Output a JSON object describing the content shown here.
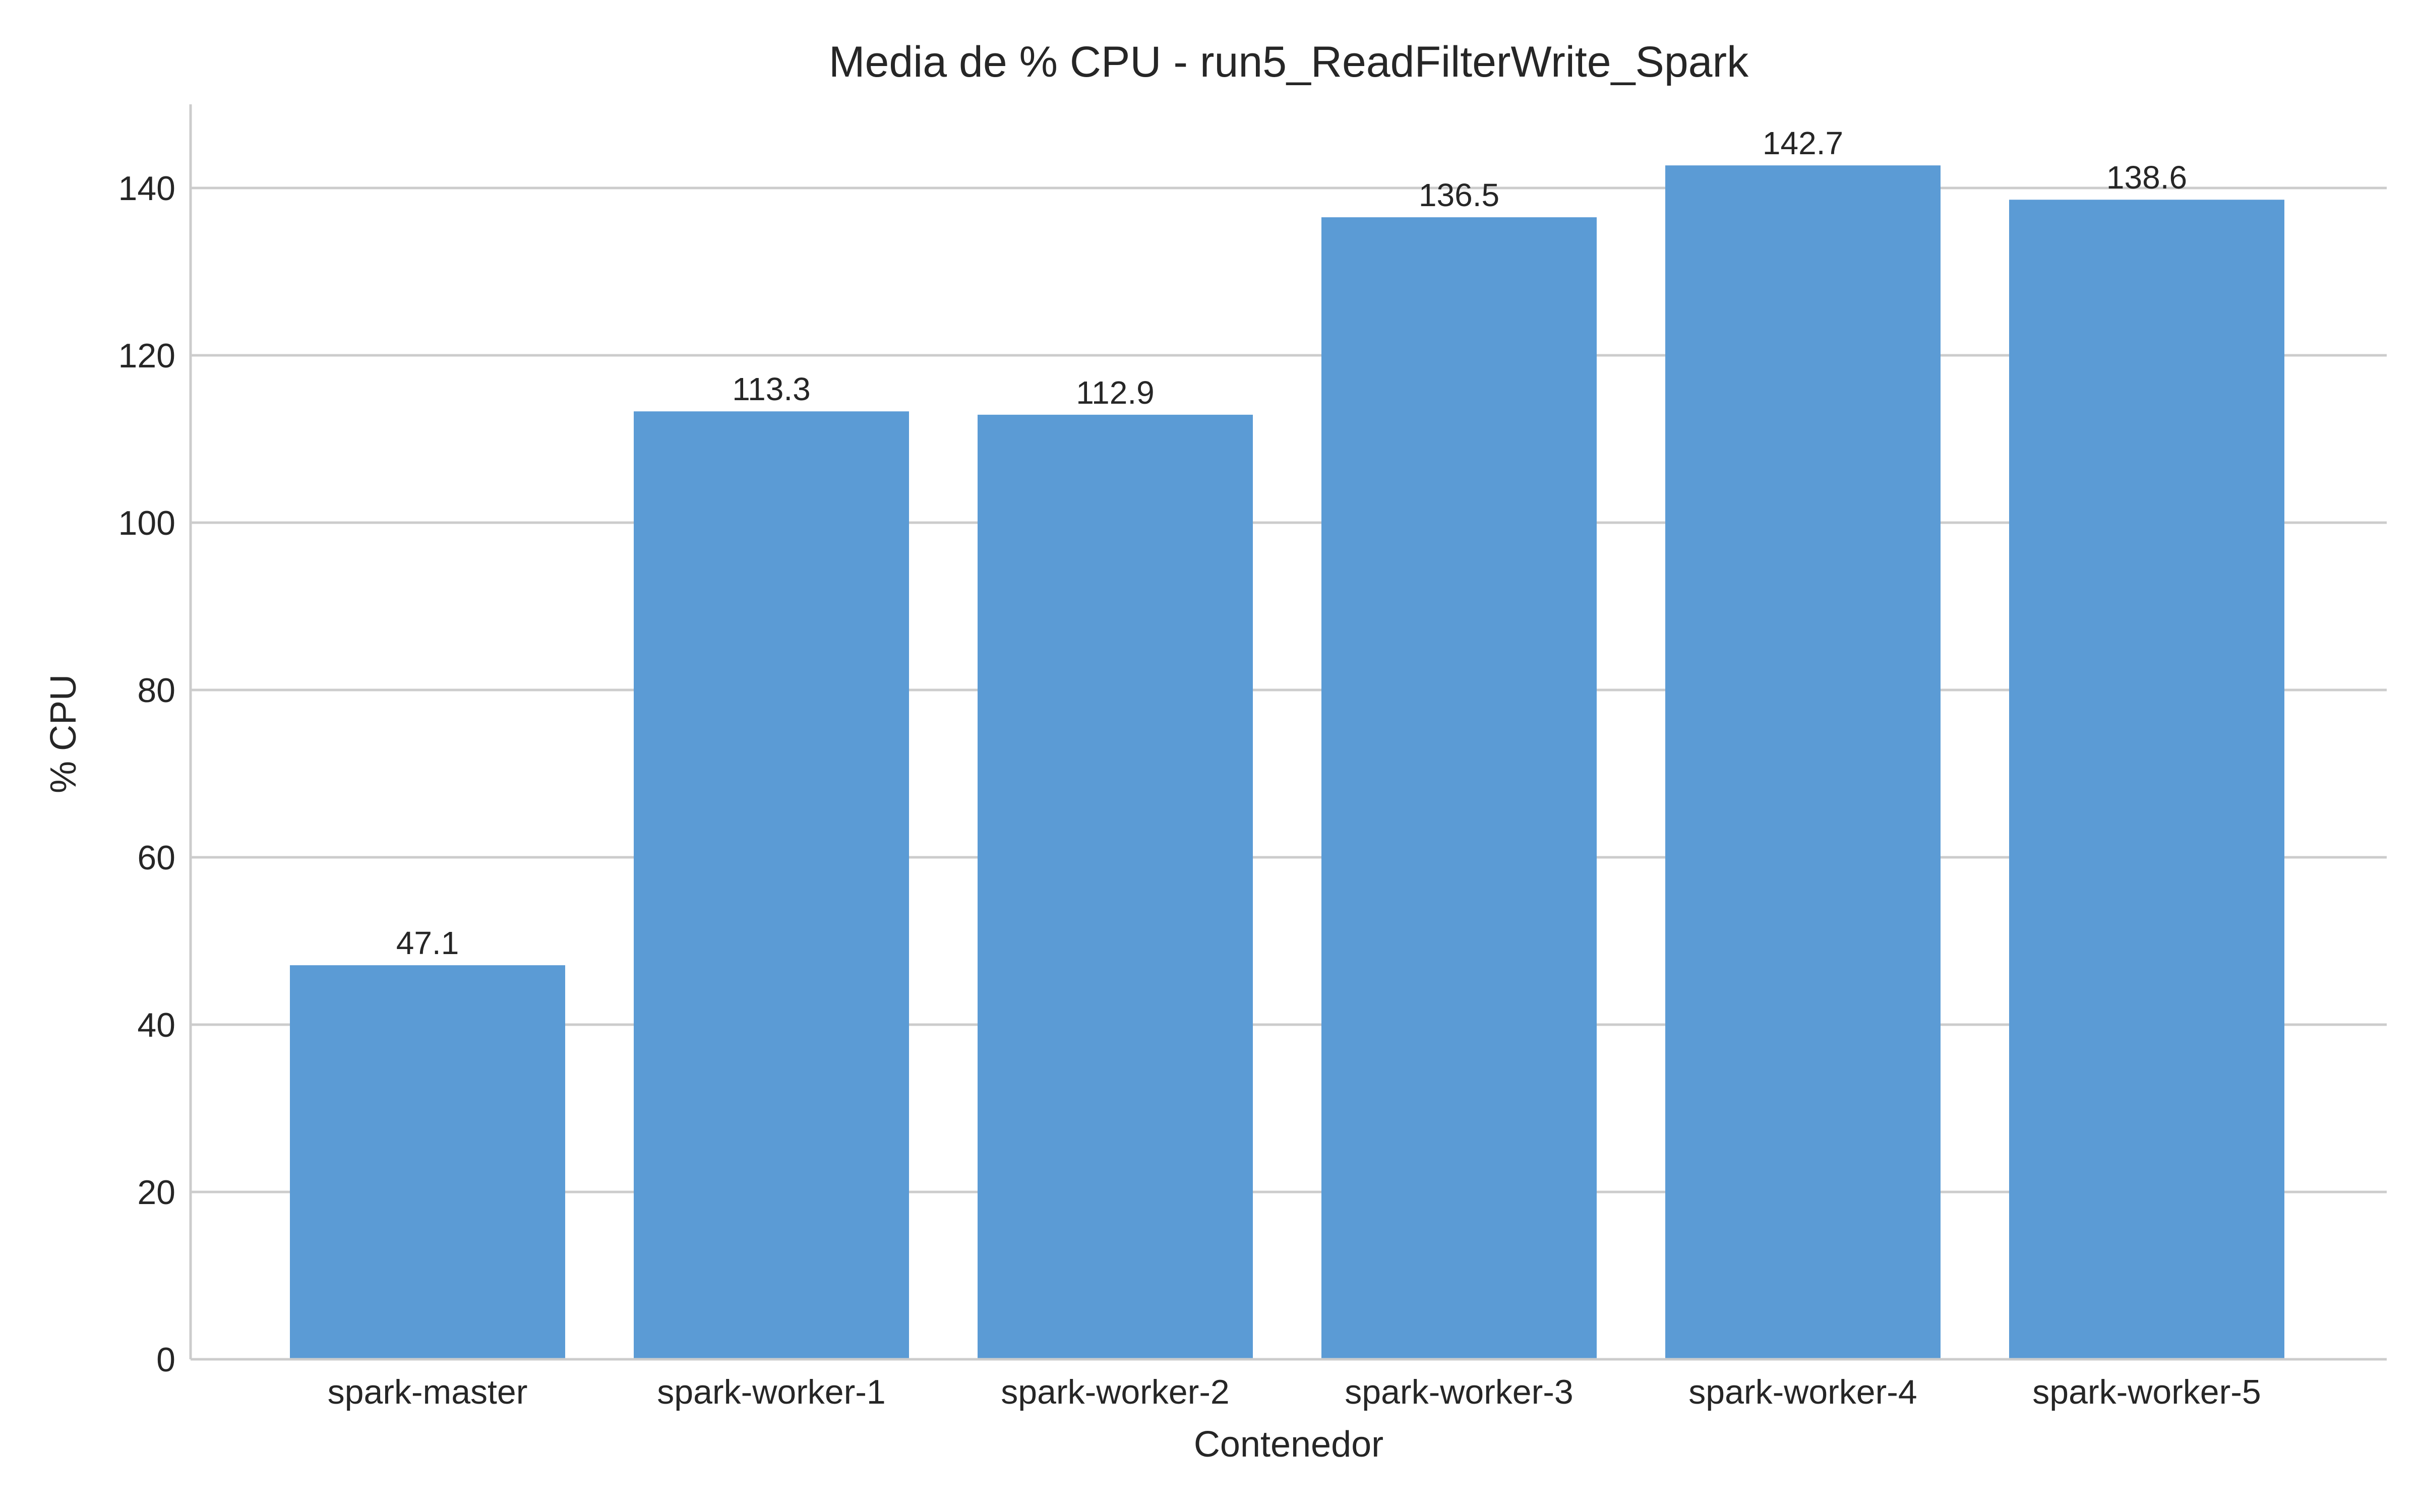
{
  "chart_data": {
    "type": "bar",
    "title": "Media de % CPU - run5_ReadFilterWrite_Spark",
    "xlabel": "Contenedor",
    "ylabel": "% CPU",
    "categories": [
      "spark-master",
      "spark-worker-1",
      "spark-worker-2",
      "spark-worker-3",
      "spark-worker-4",
      "spark-worker-5"
    ],
    "values": [
      47.1,
      113.3,
      112.9,
      136.5,
      142.7,
      138.6
    ],
    "value_labels": [
      "47.1",
      "113.3",
      "112.9",
      "136.5",
      "142.7",
      "138.6"
    ],
    "yticks": [
      0,
      20,
      40,
      60,
      80,
      100,
      120,
      140
    ],
    "ylim": [
      0,
      150
    ],
    "grid": "horizontal",
    "legend": "none",
    "colors": {
      "bar": "#5b9bd5",
      "grid": "#cccccc",
      "axis": "#cccccc",
      "text": "#262626"
    }
  }
}
